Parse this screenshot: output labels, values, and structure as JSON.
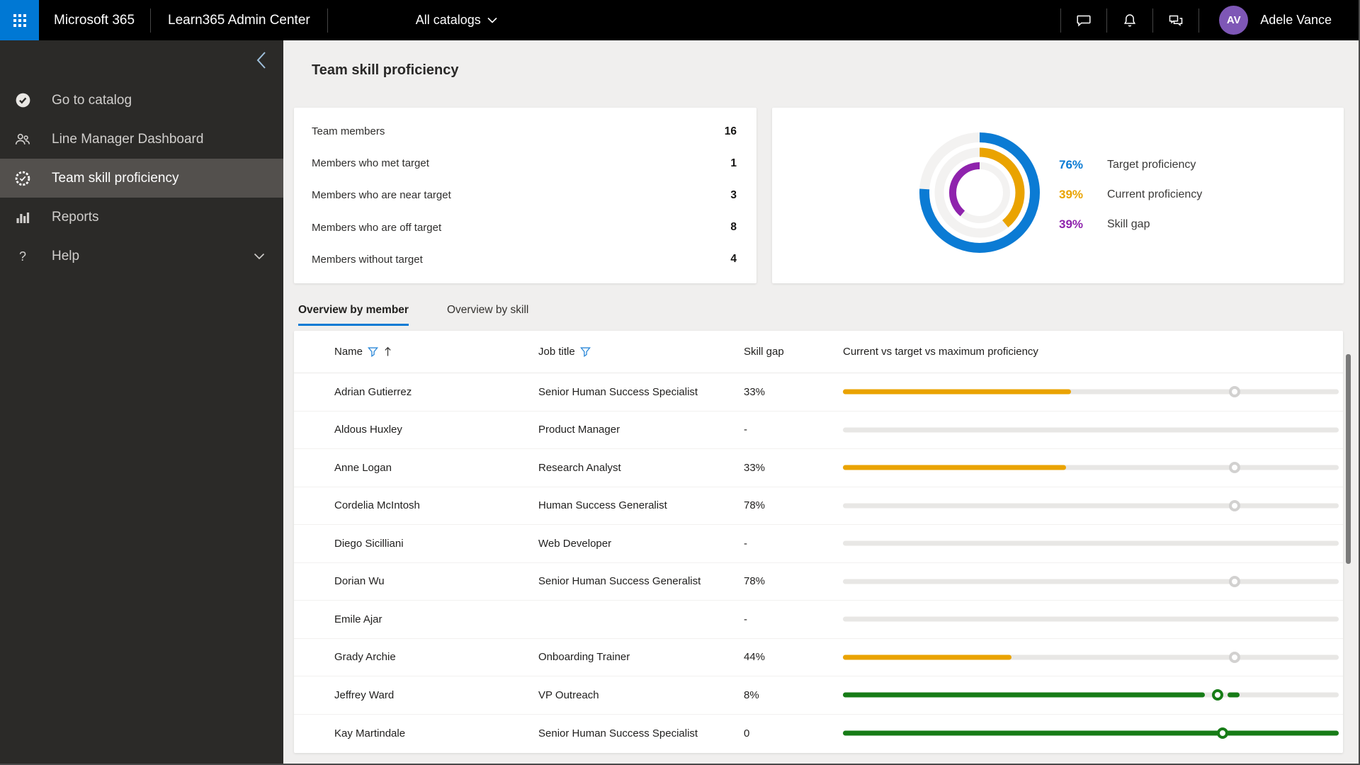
{
  "top_bar": {
    "brand": "Microsoft 365",
    "app_title": "Learn365 Admin Center",
    "catalog_dropdown": "All catalogs",
    "icons": [
      "chat-icon",
      "bell-icon",
      "feedback-icon"
    ],
    "user_initials": "AV",
    "user_name": "Adele Vance",
    "colors": {
      "waffle_bg": "#0078d4",
      "avatar_bg": "#7e57b6"
    }
  },
  "sidebar": {
    "items": [
      {
        "label": "Go to catalog",
        "icon": "catalog-check-icon",
        "selected": false,
        "has_chevron": false
      },
      {
        "label": "Line Manager Dashboard",
        "icon": "people-icon",
        "selected": false,
        "has_chevron": false
      },
      {
        "label": "Team skill proficiency",
        "icon": "skill-badge-icon",
        "selected": true,
        "has_chevron": false
      },
      {
        "label": "Reports",
        "icon": "bar-chart-icon",
        "selected": false,
        "has_chevron": false
      },
      {
        "label": "Help",
        "icon": "question-icon",
        "selected": false,
        "has_chevron": true
      }
    ]
  },
  "page": {
    "title": "Team skill proficiency"
  },
  "stats_card": {
    "rows": [
      {
        "label": "Team members",
        "value": "16"
      },
      {
        "label": "Members who met target",
        "value": "1"
      },
      {
        "label": "Members who are near target",
        "value": "3"
      },
      {
        "label": "Members who are off target",
        "value": "8"
      },
      {
        "label": "Members without target",
        "value": "4"
      }
    ]
  },
  "chart_data": {
    "type": "donut-rings",
    "title": "Team proficiency summary",
    "track_color": "#f3f2f1",
    "rings": [
      {
        "name": "Target proficiency",
        "value": 76,
        "color": "#0b7bd4",
        "radius": 78,
        "stroke": 14,
        "direction": "cw"
      },
      {
        "name": "Current proficiency",
        "value": 39,
        "color": "#eaa300",
        "radius": 57,
        "stroke": 13,
        "direction": "cw"
      },
      {
        "name": "Skill gap",
        "value": 39,
        "color": "#8f23ad",
        "radius": 38,
        "stroke": 10,
        "direction": "ccw"
      }
    ],
    "legend": [
      {
        "value": "76%",
        "label": "Target proficiency",
        "color": "#0b7bd4"
      },
      {
        "value": "39%",
        "label": "Current proficiency",
        "color": "#eaa300"
      },
      {
        "value": "39%",
        "label": "Skill gap",
        "color": "#8f23ad"
      }
    ],
    "legend_position": "right"
  },
  "tabs": [
    {
      "label": "Overview by member",
      "active": true
    },
    {
      "label": "Overview by skill",
      "active": false
    }
  ],
  "table": {
    "columns": [
      "Name",
      "Job title",
      "Skill gap",
      "Current vs target vs maximum proficiency"
    ],
    "rows": [
      {
        "name": "Adrian Gutierrez",
        "job_title": "Senior Human Success Specialist",
        "skill_gap": "33%",
        "bar": {
          "fill_pct": 46,
          "fill_color": "#eaa300",
          "marker_pct": 79,
          "marker_color": "#d2d1d0",
          "dash": null
        }
      },
      {
        "name": "Aldous Huxley",
        "job_title": "Product Manager",
        "skill_gap": "-",
        "bar": {
          "fill_pct": 0,
          "fill_color": null,
          "marker_pct": null,
          "marker_color": null,
          "dash": null
        }
      },
      {
        "name": "Anne Logan",
        "job_title": "Research Analyst",
        "skill_gap": "33%",
        "bar": {
          "fill_pct": 45,
          "fill_color": "#eaa300",
          "marker_pct": 79,
          "marker_color": "#d2d1d0",
          "dash": null
        }
      },
      {
        "name": "Cordelia McIntosh",
        "job_title": "Human Success Generalist",
        "skill_gap": "78%",
        "bar": {
          "fill_pct": 0,
          "fill_color": null,
          "marker_pct": 79,
          "marker_color": "#d2d1d0",
          "dash": null
        }
      },
      {
        "name": "Diego Sicilliani",
        "job_title": "Web Developer",
        "skill_gap": "-",
        "bar": {
          "fill_pct": 0,
          "fill_color": null,
          "marker_pct": null,
          "marker_color": null,
          "dash": null
        }
      },
      {
        "name": "Dorian Wu",
        "job_title": "Senior Human Success Generalist",
        "skill_gap": "78%",
        "bar": {
          "fill_pct": 0,
          "fill_color": null,
          "marker_pct": 79,
          "marker_color": "#d2d1d0",
          "dash": null
        }
      },
      {
        "name": "Emile Ajar",
        "job_title": "",
        "skill_gap": "-",
        "bar": {
          "fill_pct": 0,
          "fill_color": null,
          "marker_pct": null,
          "marker_color": null,
          "dash": null
        }
      },
      {
        "name": "Grady Archie",
        "job_title": "Onboarding Trainer",
        "skill_gap": "44%",
        "bar": {
          "fill_pct": 34,
          "fill_color": "#eaa300",
          "marker_pct": 79,
          "marker_color": "#d2d1d0",
          "dash": null
        }
      },
      {
        "name": "Jeffrey Ward",
        "job_title": "VP Outreach",
        "skill_gap": "8%",
        "bar": {
          "fill_pct": 73,
          "fill_color": "#177c17",
          "marker_pct": 75.5,
          "marker_color": "#177c17",
          "dash": {
            "start": 77.5,
            "end": 80
          }
        }
      },
      {
        "name": "Kay Martindale",
        "job_title": "Senior Human Success Specialist",
        "skill_gap": "0",
        "bar": {
          "fill_pct": 100,
          "fill_color": "#177c17",
          "marker_pct": 76.5,
          "marker_color": "#177c17",
          "dash": null
        }
      }
    ]
  }
}
